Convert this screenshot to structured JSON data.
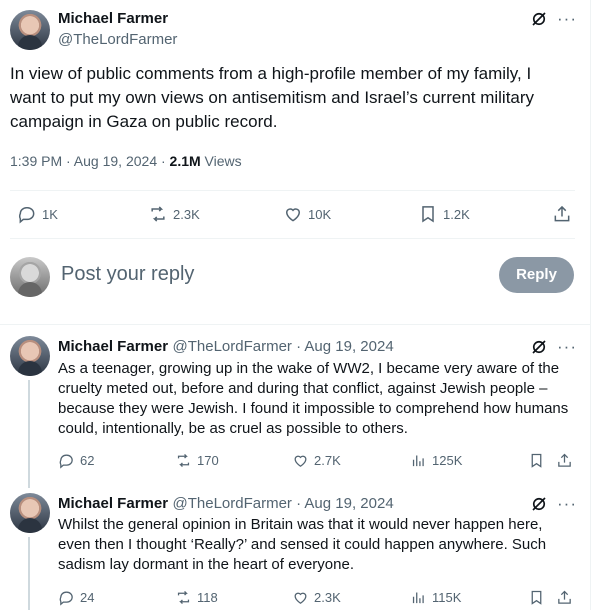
{
  "main_tweet": {
    "author_name": "Michael Farmer",
    "author_handle": "@TheLordFarmer",
    "text": "In view of public comments from a high-profile member of my family, I want to put my own views on antisemitism and Israel’s current military campaign in Gaza on public record.",
    "time": "1:39 PM · Aug 19, 2024 · ",
    "views_count": "2.1M",
    "views_label": " Views",
    "stats": {
      "replies": "1K",
      "reposts": "2.3K",
      "likes": "10K",
      "bookmarks": "1.2K"
    }
  },
  "reply_composer": {
    "placeholder": "Post your reply",
    "button_label": "Reply"
  },
  "replies": [
    {
      "author_name": "Michael Farmer",
      "author_handle": "@TheLordFarmer · Aug 19, 2024",
      "text": "As a teenager, growing up in the wake of WW2, I became very aware of the cruelty meted out, before and during that conflict, against Jewish people – because they were Jewish. I found it impossible to comprehend how humans could, intentionally, be as cruel as possible to others.",
      "stats": {
        "replies": "62",
        "reposts": "170",
        "likes": "2.7K",
        "views": "125K"
      }
    },
    {
      "author_name": "Michael Farmer",
      "author_handle": "@TheLordFarmer · Aug 19, 2024",
      "text": "Whilst the general opinion in Britain was that it would never happen here, even then I thought ‘Really?’ and sensed it could happen anywhere. Such sadism lay dormant in the heart of everyone.",
      "stats": {
        "replies": "24",
        "reposts": "118",
        "likes": "2.3K",
        "views": "115K"
      }
    }
  ],
  "icons": {
    "grok": "grok-icon",
    "more": "more-icon",
    "reply": "reply-icon",
    "repost": "repost-icon",
    "like": "like-icon",
    "bookmark": "bookmark-icon",
    "share": "share-icon",
    "views": "views-icon"
  },
  "colors": {
    "text": "#0f1419",
    "secondary": "#536471",
    "reply_button": "#8b98a5",
    "divider": "#eff3f4"
  },
  "more_glyph": "···"
}
